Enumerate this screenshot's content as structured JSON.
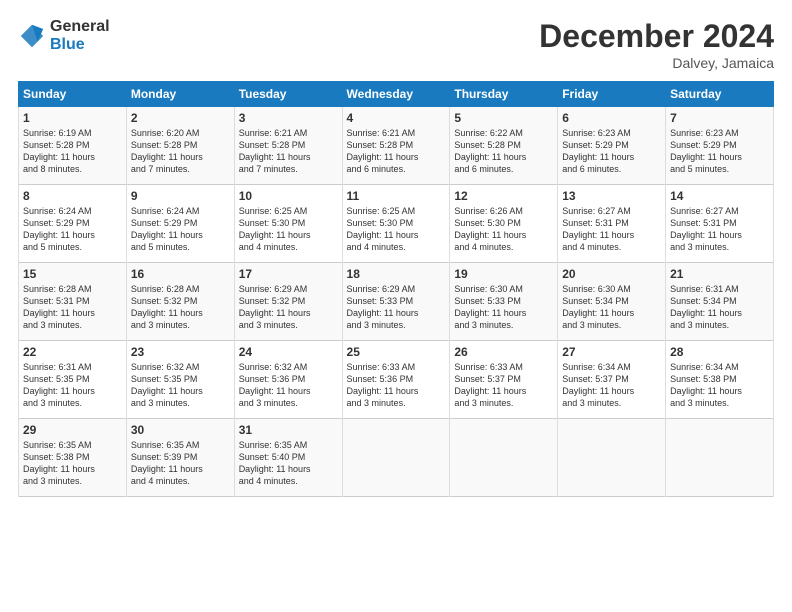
{
  "logo": {
    "general": "General",
    "blue": "Blue"
  },
  "title": "December 2024",
  "location": "Dalvey, Jamaica",
  "days_header": [
    "Sunday",
    "Monday",
    "Tuesday",
    "Wednesday",
    "Thursday",
    "Friday",
    "Saturday"
  ],
  "weeks": [
    [
      {
        "day": "1",
        "text": "Sunrise: 6:19 AM\nSunset: 5:28 PM\nDaylight: 11 hours\nand 8 minutes."
      },
      {
        "day": "2",
        "text": "Sunrise: 6:20 AM\nSunset: 5:28 PM\nDaylight: 11 hours\nand 7 minutes."
      },
      {
        "day": "3",
        "text": "Sunrise: 6:21 AM\nSunset: 5:28 PM\nDaylight: 11 hours\nand 7 minutes."
      },
      {
        "day": "4",
        "text": "Sunrise: 6:21 AM\nSunset: 5:28 PM\nDaylight: 11 hours\nand 6 minutes."
      },
      {
        "day": "5",
        "text": "Sunrise: 6:22 AM\nSunset: 5:28 PM\nDaylight: 11 hours\nand 6 minutes."
      },
      {
        "day": "6",
        "text": "Sunrise: 6:23 AM\nSunset: 5:29 PM\nDaylight: 11 hours\nand 6 minutes."
      },
      {
        "day": "7",
        "text": "Sunrise: 6:23 AM\nSunset: 5:29 PM\nDaylight: 11 hours\nand 5 minutes."
      }
    ],
    [
      {
        "day": "8",
        "text": "Sunrise: 6:24 AM\nSunset: 5:29 PM\nDaylight: 11 hours\nand 5 minutes."
      },
      {
        "day": "9",
        "text": "Sunrise: 6:24 AM\nSunset: 5:29 PM\nDaylight: 11 hours\nand 5 minutes."
      },
      {
        "day": "10",
        "text": "Sunrise: 6:25 AM\nSunset: 5:30 PM\nDaylight: 11 hours\nand 4 minutes."
      },
      {
        "day": "11",
        "text": "Sunrise: 6:25 AM\nSunset: 5:30 PM\nDaylight: 11 hours\nand 4 minutes."
      },
      {
        "day": "12",
        "text": "Sunrise: 6:26 AM\nSunset: 5:30 PM\nDaylight: 11 hours\nand 4 minutes."
      },
      {
        "day": "13",
        "text": "Sunrise: 6:27 AM\nSunset: 5:31 PM\nDaylight: 11 hours\nand 4 minutes."
      },
      {
        "day": "14",
        "text": "Sunrise: 6:27 AM\nSunset: 5:31 PM\nDaylight: 11 hours\nand 3 minutes."
      }
    ],
    [
      {
        "day": "15",
        "text": "Sunrise: 6:28 AM\nSunset: 5:31 PM\nDaylight: 11 hours\nand 3 minutes."
      },
      {
        "day": "16",
        "text": "Sunrise: 6:28 AM\nSunset: 5:32 PM\nDaylight: 11 hours\nand 3 minutes."
      },
      {
        "day": "17",
        "text": "Sunrise: 6:29 AM\nSunset: 5:32 PM\nDaylight: 11 hours\nand 3 minutes."
      },
      {
        "day": "18",
        "text": "Sunrise: 6:29 AM\nSunset: 5:33 PM\nDaylight: 11 hours\nand 3 minutes."
      },
      {
        "day": "19",
        "text": "Sunrise: 6:30 AM\nSunset: 5:33 PM\nDaylight: 11 hours\nand 3 minutes."
      },
      {
        "day": "20",
        "text": "Sunrise: 6:30 AM\nSunset: 5:34 PM\nDaylight: 11 hours\nand 3 minutes."
      },
      {
        "day": "21",
        "text": "Sunrise: 6:31 AM\nSunset: 5:34 PM\nDaylight: 11 hours\nand 3 minutes."
      }
    ],
    [
      {
        "day": "22",
        "text": "Sunrise: 6:31 AM\nSunset: 5:35 PM\nDaylight: 11 hours\nand 3 minutes."
      },
      {
        "day": "23",
        "text": "Sunrise: 6:32 AM\nSunset: 5:35 PM\nDaylight: 11 hours\nand 3 minutes."
      },
      {
        "day": "24",
        "text": "Sunrise: 6:32 AM\nSunset: 5:36 PM\nDaylight: 11 hours\nand 3 minutes."
      },
      {
        "day": "25",
        "text": "Sunrise: 6:33 AM\nSunset: 5:36 PM\nDaylight: 11 hours\nand 3 minutes."
      },
      {
        "day": "26",
        "text": "Sunrise: 6:33 AM\nSunset: 5:37 PM\nDaylight: 11 hours\nand 3 minutes."
      },
      {
        "day": "27",
        "text": "Sunrise: 6:34 AM\nSunset: 5:37 PM\nDaylight: 11 hours\nand 3 minutes."
      },
      {
        "day": "28",
        "text": "Sunrise: 6:34 AM\nSunset: 5:38 PM\nDaylight: 11 hours\nand 3 minutes."
      }
    ],
    [
      {
        "day": "29",
        "text": "Sunrise: 6:35 AM\nSunset: 5:38 PM\nDaylight: 11 hours\nand 3 minutes."
      },
      {
        "day": "30",
        "text": "Sunrise: 6:35 AM\nSunset: 5:39 PM\nDaylight: 11 hours\nand 4 minutes."
      },
      {
        "day": "31",
        "text": "Sunrise: 6:35 AM\nSunset: 5:40 PM\nDaylight: 11 hours\nand 4 minutes."
      },
      {
        "day": "",
        "text": ""
      },
      {
        "day": "",
        "text": ""
      },
      {
        "day": "",
        "text": ""
      },
      {
        "day": "",
        "text": ""
      }
    ]
  ]
}
